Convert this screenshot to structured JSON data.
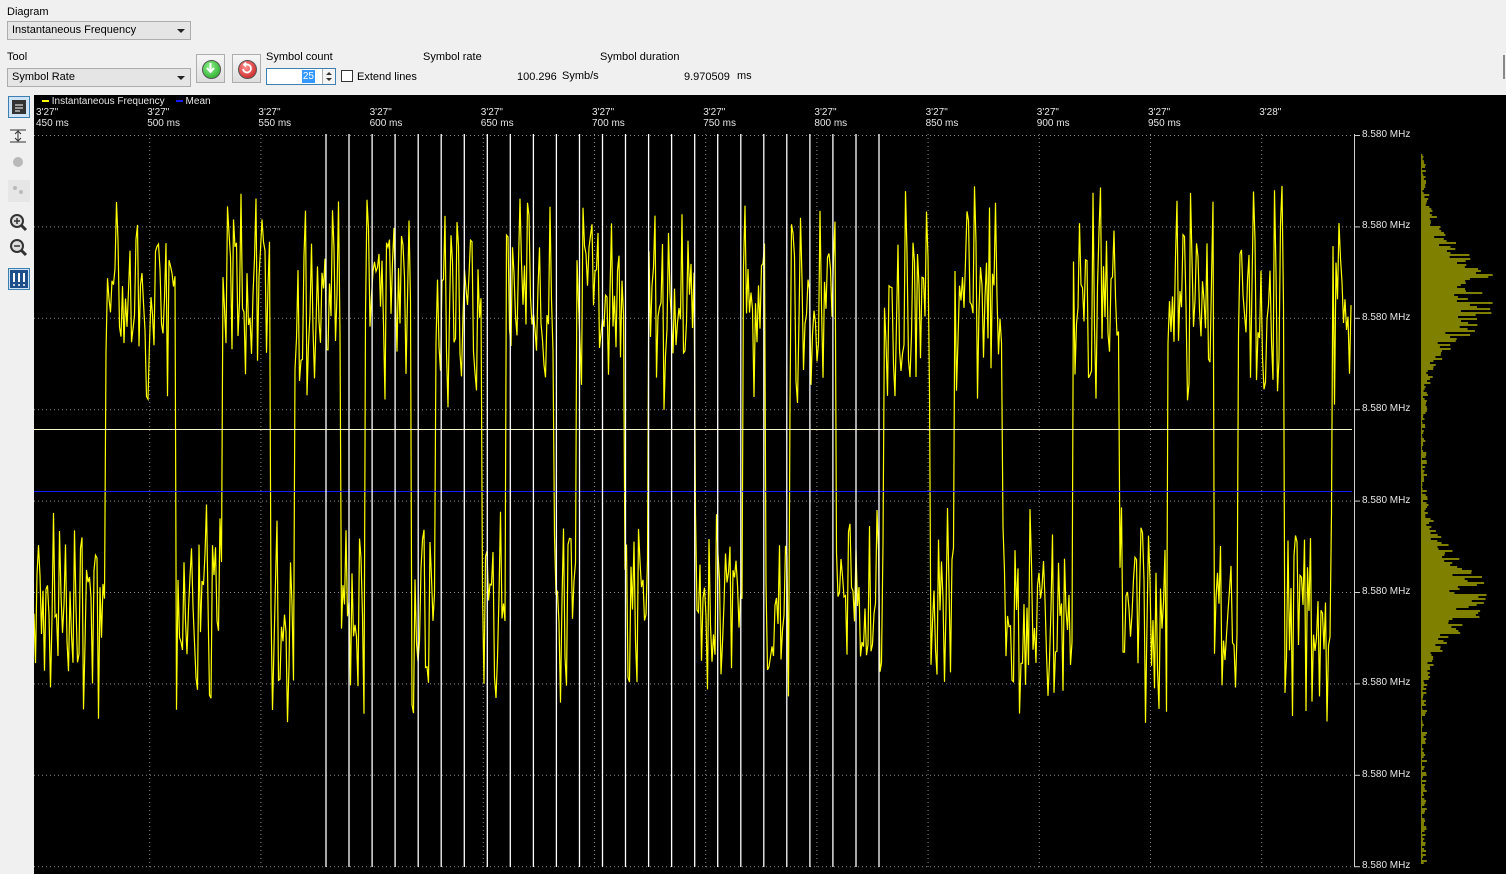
{
  "diagram": {
    "label": "Diagram",
    "selected": "Instantaneous Frequency"
  },
  "tool": {
    "label": "Tool",
    "selected": "Symbol Rate"
  },
  "buttons": {
    "apply_icon": "green-arrow-down-icon",
    "reset_icon": "red-undo-icon"
  },
  "symbol_count": {
    "label": "Symbol count",
    "value": "25"
  },
  "extend_lines": {
    "label": "Extend lines",
    "checked": false
  },
  "symbol_rate": {
    "label": "Symbol rate",
    "value": "100.296",
    "unit": "Symb/s"
  },
  "symbol_duration": {
    "label": "Symbol duration",
    "value": "9.970509",
    "unit": "ms"
  },
  "left_toolbar": [
    "select-tool-icon",
    "vertical-scale-icon",
    "grey-tool-icon",
    "grey-dots-icon",
    "zoom-in-icon",
    "zoom-out-icon",
    "markers-icon"
  ],
  "chart_data": {
    "type": "line",
    "legend": [
      {
        "name": "Instantaneous Frequency",
        "color": "#ffff00"
      },
      {
        "name": "Mean",
        "color": "#1a1aff"
      }
    ],
    "x_ticks": [
      {
        "line1": "3'27\"",
        "line2": "450 ms"
      },
      {
        "line1": "3'27\"",
        "line2": "500 ms"
      },
      {
        "line1": "3'27\"",
        "line2": "550 ms"
      },
      {
        "line1": "3'27\"",
        "line2": "600 ms"
      },
      {
        "line1": "3'27\"",
        "line2": "650 ms"
      },
      {
        "line1": "3'27\"",
        "line2": "700 ms"
      },
      {
        "line1": "3'27\"",
        "line2": "750 ms"
      },
      {
        "line1": "3'27\"",
        "line2": "800 ms"
      },
      {
        "line1": "3'27\"",
        "line2": "850 ms"
      },
      {
        "line1": "3'27\"",
        "line2": "900 ms"
      },
      {
        "line1": "3'27\"",
        "line2": "950 ms"
      },
      {
        "line1": "3'28\"",
        "line2": ""
      }
    ],
    "y_ticks": [
      "8.580 MHz",
      "8.580 MHz",
      "8.580 MHz",
      "8.580 MHz",
      "8.580 MHz",
      "8.580 MHz",
      "8.580 MHz",
      "8.580 MHz",
      "8.580 MHz"
    ],
    "x_range_ms": [
      450,
      1000
    ],
    "symbol_markers": 25,
    "grid": true,
    "histogram": "right"
  }
}
